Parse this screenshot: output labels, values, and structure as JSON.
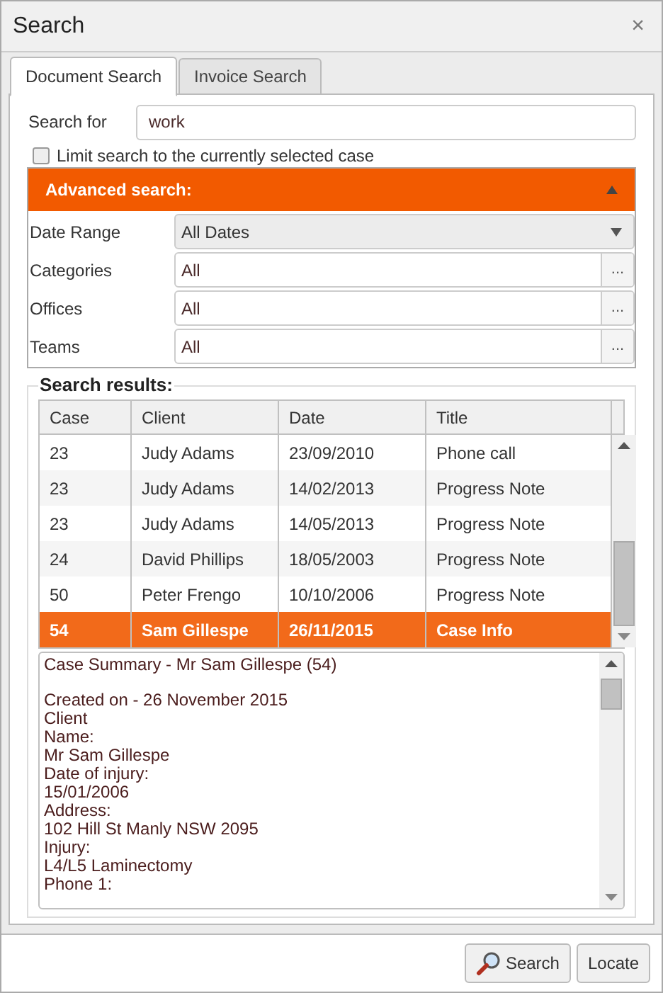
{
  "window": {
    "title": "Search",
    "close": "×"
  },
  "tabs": [
    {
      "label": "Document Search",
      "selected": true
    },
    {
      "label": "Invoice Search",
      "selected": false
    }
  ],
  "search_for": {
    "label": "Search for",
    "value": "work"
  },
  "limit_checkbox": {
    "label": "Limit search to the currently selected case",
    "checked": false
  },
  "advanced": {
    "title": "Advanced search:",
    "expanded": true,
    "fields": [
      {
        "kind": "dropdown",
        "label": "Date Range",
        "value": "All Dates"
      },
      {
        "kind": "picker",
        "label": "Categories",
        "value": "All",
        "button": "..."
      },
      {
        "kind": "picker",
        "label": "Offices",
        "value": "All",
        "button": "..."
      },
      {
        "kind": "picker",
        "label": "Teams",
        "value": "All",
        "button": "..."
      }
    ]
  },
  "results": {
    "title": "Search results:",
    "columns": [
      "Case",
      "Client",
      "Date",
      "Title"
    ],
    "rows": [
      {
        "cells": [
          "23",
          "Judy Adams",
          "23/09/2010",
          "Phone call"
        ],
        "selected": false
      },
      {
        "cells": [
          "23",
          "Judy Adams",
          "14/02/2013",
          "Progress Note"
        ],
        "selected": false
      },
      {
        "cells": [
          "23",
          "Judy Adams",
          "14/05/2013",
          "Progress Note"
        ],
        "selected": false
      },
      {
        "cells": [
          "24",
          "David Phillips",
          "18/05/2003",
          "Progress Note"
        ],
        "selected": false
      },
      {
        "cells": [
          "50",
          "Peter Frengo",
          "10/10/2006",
          "Progress Note"
        ],
        "selected": false
      },
      {
        "cells": [
          "54",
          "Sam Gillespe",
          "26/11/2015",
          "Case Info"
        ],
        "selected": true
      }
    ]
  },
  "summary": {
    "paragraphs": [
      [
        "Case Summary - Mr Sam Gillespe (54)"
      ],
      [
        "Created on - 26 November 2015",
        "Client",
        "Name:",
        "Mr Sam Gillespe",
        "Date of injury:",
        "15/01/2006",
        "Address:",
        "102 Hill St Manly NSW 2095",
        "Injury:",
        "L4/L5 Laminectomy",
        "Phone 1:"
      ]
    ]
  },
  "buttons": [
    {
      "kind": "search",
      "label": "Search"
    },
    {
      "kind": "plain",
      "label": "Locate"
    }
  ]
}
